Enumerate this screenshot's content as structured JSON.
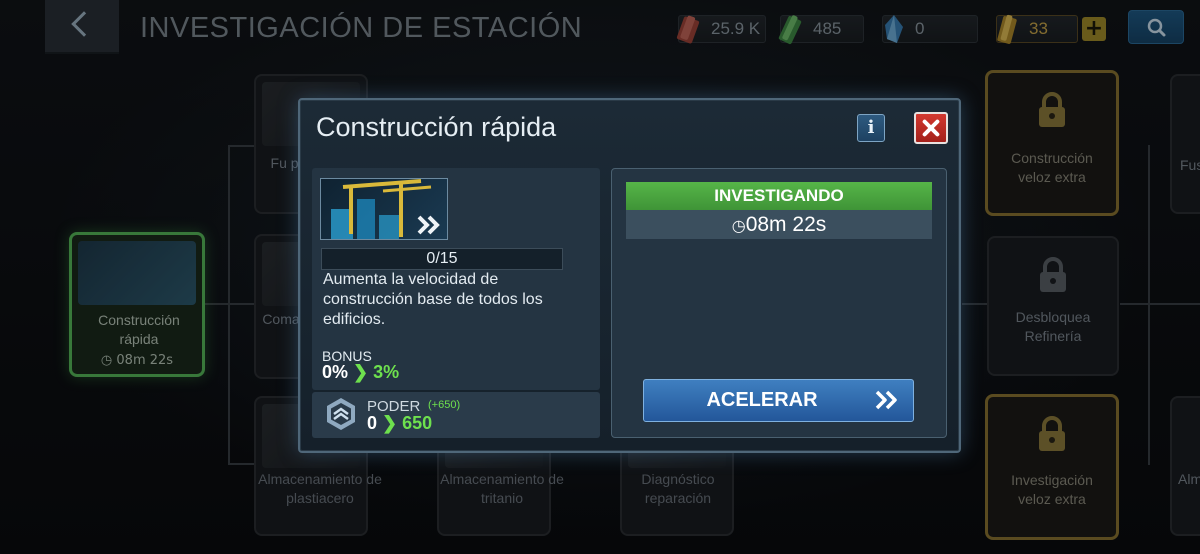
{
  "header": {
    "title": "INVESTIGACIÓN DE ESTACIÓN",
    "resources": [
      {
        "icon": "tritanium-icon",
        "value": "25.9 K"
      },
      {
        "icon": "crystal-icon",
        "value": "485"
      },
      {
        "icon": "dilithium-icon",
        "value": "0"
      },
      {
        "icon": "latinum-icon",
        "value": "33"
      }
    ]
  },
  "tree": {
    "nodes": [
      {
        "label": "Construcción rápida",
        "timer": "08m 22s"
      },
      {
        "label": "Fu pla"
      },
      {
        "label": "Coma"
      },
      {
        "label": "Construcción veloz extra"
      },
      {
        "label": "Desbloquea Refinería"
      },
      {
        "label": "Investigación veloz extra"
      },
      {
        "label": "Fus"
      },
      {
        "label": "Alm"
      }
    ],
    "bottom_labels": [
      "Almacenamiento de plastiacero",
      "Almacenamiento de tritanio",
      "Diagnóstico reparación"
    ]
  },
  "modal": {
    "title": "Construcción rápida",
    "info_label": "i",
    "level": "0/15",
    "description": "Aumenta la velocidad de construcción base de todos los edificios.",
    "bonus_label": "BONUS",
    "bonus_from": "0%",
    "bonus_to": "3%",
    "power_label": "PODER",
    "power_delta": "(+650)",
    "power_from": "0",
    "power_to": "650",
    "status": "INVESTIGANDO",
    "timer": "08m 22s",
    "speed_button": "ACELERAR"
  },
  "colors": {
    "status_green": "#56b548",
    "button_blue": "#3f7fc0",
    "close_red": "#d3382f",
    "gold": "#c9a64a"
  }
}
